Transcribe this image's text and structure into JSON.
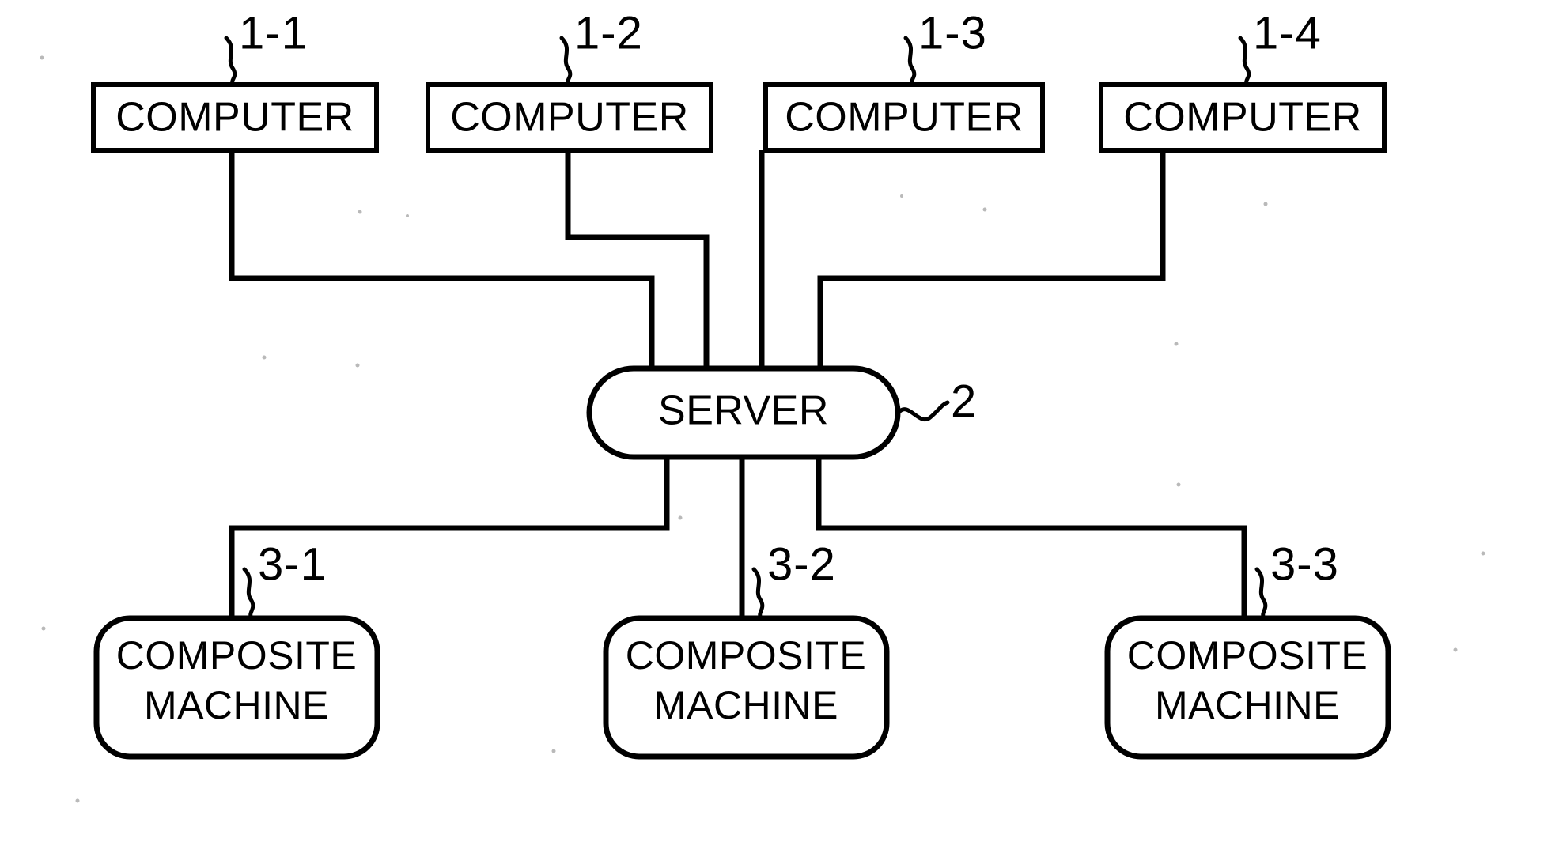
{
  "figure": {
    "type": "patent-block-diagram",
    "background_color": "#ffffff",
    "line_color": "#000000"
  },
  "computers": [
    {
      "label": "COMPUTER",
      "ref": "1-1"
    },
    {
      "label": "COMPUTER",
      "ref": "1-2"
    },
    {
      "label": "COMPUTER",
      "ref": "1-3"
    },
    {
      "label": "COMPUTER",
      "ref": "1-4"
    }
  ],
  "server": {
    "label": "SERVER",
    "ref": "2"
  },
  "composite_machines": [
    {
      "label_line1": "COMPOSITE",
      "label_line2": "MACHINE",
      "ref": "3-1"
    },
    {
      "label_line1": "COMPOSITE",
      "label_line2": "MACHINE",
      "ref": "3-2"
    },
    {
      "label_line1": "COMPOSITE",
      "label_line2": "MACHINE",
      "ref": "3-3"
    }
  ]
}
